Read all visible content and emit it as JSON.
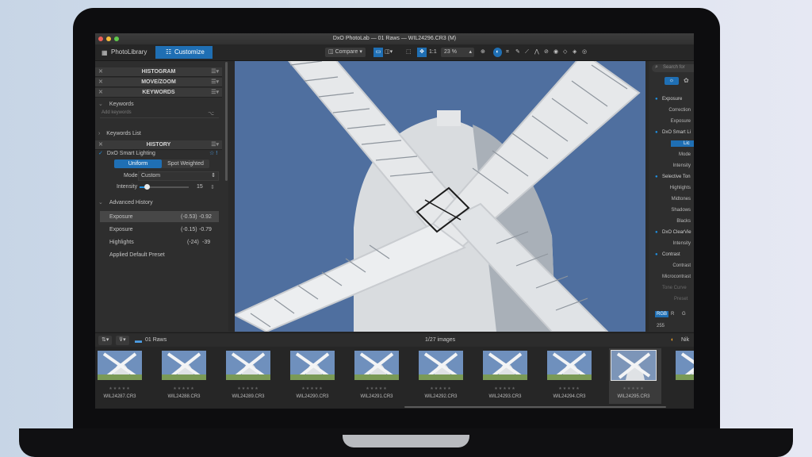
{
  "window": {
    "title": "DxO PhotoLab — 01 Raws — WIL24296.CR3 (M)"
  },
  "tabs": [
    {
      "label": "PhotoLibrary"
    },
    {
      "label": "Customize"
    }
  ],
  "toolbar": {
    "compare_label": "Compare",
    "ratio_label": "1:1",
    "zoom_value": "23 %"
  },
  "left_panel": {
    "sections": {
      "histogram": "HISTOGRAM",
      "movezoom": "MOVE/ZOOM",
      "keywords": "KEYWORDS",
      "history": "HISTORY"
    },
    "keywords": {
      "label": "Keywords",
      "placeholder": "Add keywords",
      "list_label": "Keywords List"
    },
    "history": {
      "smart_lighting": "DxO Smart Lighting",
      "uniform": "Uniform",
      "spot_weighted": "Spot Weighted",
      "mode_label": "Mode",
      "mode_value": "Custom",
      "intensity_label": "Intensity",
      "intensity_value": "15",
      "intensity_fraction": 0.15,
      "advanced_label": "Advanced History",
      "items": [
        {
          "name": "Exposure",
          "old": "(-0.53)",
          "new": "-0.92"
        },
        {
          "name": "Exposure",
          "old": "(-0.15)",
          "new": "-0.79"
        },
        {
          "name": "Highlights",
          "old": "(-24)",
          "new": "-39"
        },
        {
          "name": "Applied Default Preset",
          "old": "",
          "new": ""
        }
      ]
    }
  },
  "right_panel": {
    "search_placeholder": "Search for",
    "items": [
      {
        "label": "Exposure",
        "kind": "header"
      },
      {
        "label": "Correction",
        "kind": "sub"
      },
      {
        "label": "Exposure",
        "kind": "sub"
      },
      {
        "label": "DxO Smart Li",
        "kind": "header"
      },
      {
        "label": "Lic",
        "kind": "button"
      },
      {
        "label": "Mode",
        "kind": "sub"
      },
      {
        "label": "Intensity",
        "kind": "sub"
      },
      {
        "label": "Selective Ton",
        "kind": "header"
      },
      {
        "label": "Highlights",
        "kind": "sub"
      },
      {
        "label": "Midtones",
        "kind": "sub"
      },
      {
        "label": "Shadows",
        "kind": "sub"
      },
      {
        "label": "Blacks",
        "kind": "sub"
      },
      {
        "label": "DxO ClearVie",
        "kind": "header"
      },
      {
        "label": "Intensity",
        "kind": "sub"
      },
      {
        "label": "Contrast",
        "kind": "header"
      },
      {
        "label": "Contrast",
        "kind": "sub"
      },
      {
        "label": "Microcontrast",
        "kind": "sub"
      },
      {
        "label": "Tone Curve",
        "kind": "dim"
      },
      {
        "label": "Preset",
        "kind": "dim"
      }
    ],
    "channels": [
      "RGB",
      "R",
      "G"
    ],
    "value_255": "255"
  },
  "filmstrip": {
    "folder": "01 Raws",
    "count": "1/27 images",
    "nik_label": "Nik",
    "stars": "★★★★★",
    "items": [
      {
        "file": "WIL24287.CR3"
      },
      {
        "file": "WIL24288.CR3"
      },
      {
        "file": "WIL24289.CR3"
      },
      {
        "file": "WIL24290.CR3"
      },
      {
        "file": "WIL24291.CR3"
      },
      {
        "file": "WIL24292.CR3"
      },
      {
        "file": "WIL24293.CR3"
      },
      {
        "file": "WIL24294.CR3"
      },
      {
        "file": "WIL24295.CR3"
      }
    ]
  },
  "colors": {
    "accent": "#1f6fb4",
    "sky": "#4e6e9e"
  }
}
